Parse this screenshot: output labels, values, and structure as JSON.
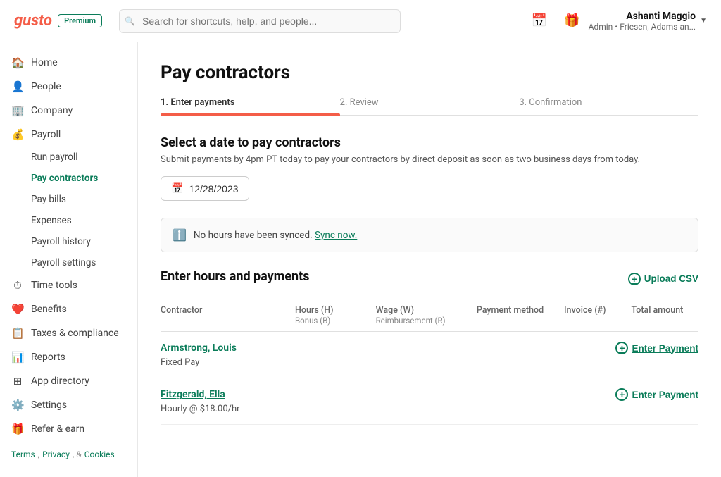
{
  "app": {
    "logo": "gusto",
    "badge": "Premium"
  },
  "header": {
    "search_placeholder": "Search for shortcuts, help, and people...",
    "user_name": "Ashanti Maggio",
    "user_role": "Admin • Friesen, Adams an..."
  },
  "sidebar": {
    "items": [
      {
        "id": "home",
        "label": "Home",
        "icon": "🏠",
        "type": "item"
      },
      {
        "id": "people",
        "label": "People",
        "icon": "👤",
        "type": "item"
      },
      {
        "id": "company",
        "label": "Company",
        "icon": "🏢",
        "type": "item"
      },
      {
        "id": "payroll",
        "label": "Payroll",
        "icon": "💰",
        "type": "item"
      },
      {
        "id": "run-payroll",
        "label": "Run payroll",
        "type": "sub"
      },
      {
        "id": "pay-contractors",
        "label": "Pay contractors",
        "type": "sub",
        "active": true
      },
      {
        "id": "pay-bills",
        "label": "Pay bills",
        "type": "sub"
      },
      {
        "id": "expenses",
        "label": "Expenses",
        "type": "sub"
      },
      {
        "id": "payroll-history",
        "label": "Payroll history",
        "type": "sub"
      },
      {
        "id": "payroll-settings",
        "label": "Payroll settings",
        "type": "sub"
      },
      {
        "id": "time-tools",
        "label": "Time tools",
        "icon": "⏱",
        "type": "item"
      },
      {
        "id": "benefits",
        "label": "Benefits",
        "icon": "❤️",
        "type": "item"
      },
      {
        "id": "taxes-compliance",
        "label": "Taxes & compliance",
        "icon": "📋",
        "type": "item"
      },
      {
        "id": "reports",
        "label": "Reports",
        "icon": "📊",
        "type": "item"
      },
      {
        "id": "app-directory",
        "label": "App directory",
        "icon": "⊞",
        "type": "item"
      },
      {
        "id": "settings",
        "label": "Settings",
        "icon": "⚙️",
        "type": "item"
      },
      {
        "id": "refer-earn",
        "label": "Refer & earn",
        "icon": "🎁",
        "type": "item"
      }
    ]
  },
  "footer": {
    "terms": "Terms",
    "privacy": "Privacy",
    "cookies": "Cookies",
    "separator1": ",",
    "separator2": ", &"
  },
  "page": {
    "title": "Pay contractors",
    "stepper": {
      "step1": "1. Enter payments",
      "step2": "2. Review",
      "step3": "3. Confirmation"
    },
    "select_date": {
      "heading": "Select a date to pay contractors",
      "subtext": "Submit payments by 4pm PT today to pay your contractors by direct deposit as soon as two business days from today.",
      "date_value": "12/28/2023"
    },
    "alert": {
      "message": "No hours have been synced.",
      "link_text": "Sync now."
    },
    "payments": {
      "heading": "Enter hours and payments",
      "upload_csv_label": "Upload CSV",
      "table_headers": {
        "contractor": "Contractor",
        "hours_bonus": "Hours (H)\nBonus (B)",
        "wage_reimbursement": "Wage (W)\nReimbursement (R)",
        "payment_method": "Payment method",
        "invoice": "Invoice (#)",
        "total_amount": "Total amount"
      },
      "contractors": [
        {
          "name": "Armstrong, Louis",
          "type": "Fixed Pay",
          "enter_payment_label": "Enter Payment"
        },
        {
          "name": "Fitzgerald, Ella",
          "type": "Hourly @ $18.00/hr",
          "enter_payment_label": "Enter Payment"
        }
      ]
    }
  }
}
